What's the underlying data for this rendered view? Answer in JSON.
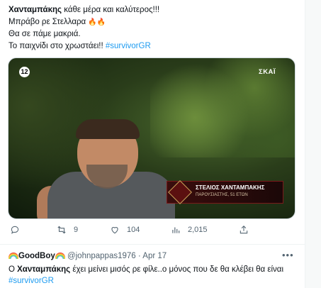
{
  "tweet1": {
    "author_mention": "Χανταμπάκης",
    "line1_rest": " κάθε μέρα και καλύτερος!!!",
    "line2": "Μπράβο ρε Στελλαρα ",
    "line3": "Θα σε πάμε μακριά.",
    "line4": "Το παιχνίδι στο χρωστάει!! ",
    "hashtag": "#survivorGR",
    "fire_emoji": "🔥🔥"
  },
  "media": {
    "rating_badge": "12",
    "channel_logo": "ΣΚΑΪ",
    "nameplate_name": "ΣΤΕΛΙΟΣ ΧΑΝΤΑΜΠΑΚΗΣ",
    "nameplate_sub": "ΠΑΡΟΥΣΙΑΣΤΗΣ, 51 ΕΤΩΝ"
  },
  "actions": {
    "replies": "",
    "retweets": "9",
    "likes": "104",
    "views": "2,015"
  },
  "tweet2": {
    "display_name": "GoodBoy",
    "handle": "@johnpappas1976",
    "separator": " · ",
    "date": "Apr 17",
    "text_prefix": "Ο ",
    "text_bold": "Χανταμπάκης",
    "text_rest": " έχει μείνει μισός ρε φίλε..ο μόνος που δε θα κλέβει θα είναι ",
    "hashtag": "#survivorGR"
  },
  "colors": {
    "link": "#1d9bf0",
    "muted": "#536471",
    "text": "#0f1419"
  },
  "icons": [
    "reply-icon",
    "retweet-icon",
    "like-icon",
    "views-icon",
    "share-icon",
    "more-icon"
  ]
}
